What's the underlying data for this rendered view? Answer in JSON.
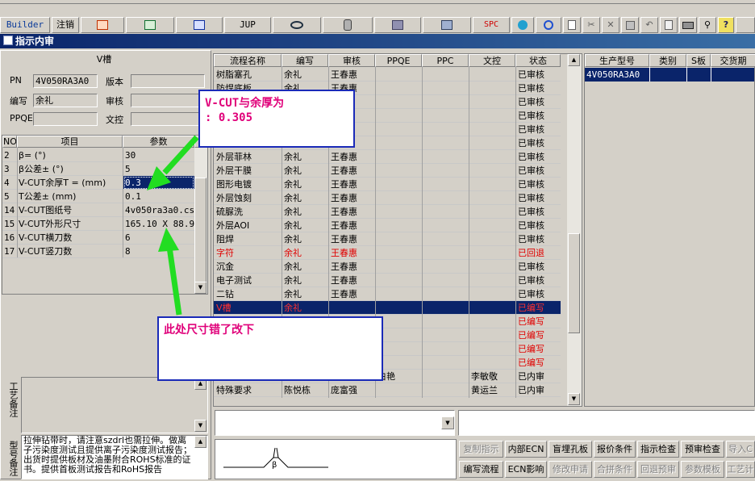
{
  "toolbar": {
    "builder_label": "Builder",
    "logout_label": "注销",
    "jup_label": "JUP",
    "spc_label": "SPC",
    "icons": [
      "ppt-icon",
      "excel-icon",
      "word-icon",
      "eye-icon",
      "database-icon",
      "server-icon",
      "printer-queue-icon",
      "spc",
      "globe-icon",
      "refresh-icon",
      "new-doc-icon",
      "cut-icon",
      "delete-icon",
      "save-icon",
      "undo-icon",
      "preview-icon",
      "print-icon",
      "find-icon",
      "help-icon"
    ]
  },
  "window": {
    "title": "指示内审"
  },
  "left": {
    "header": "V槽",
    "pn_label": "PN",
    "pn_value": "4V050RA3A0",
    "version_label": "版本",
    "author_label": "编写",
    "author_value": "余礼",
    "review_label": "审核",
    "ppqe_label": "PPQE",
    "control_label": "文控",
    "param_columns": [
      "NO",
      "项目",
      "参数"
    ],
    "params": [
      {
        "no": "2",
        "item": "β=  (°)",
        "value": "30"
      },
      {
        "no": "3",
        "item": "β公差±  (°)",
        "value": "5"
      },
      {
        "no": "4",
        "item": "V-CUT余厚T =  (mm)",
        "value": "0.3"
      },
      {
        "no": "5",
        "item": "T公差±  (mm)",
        "value": "0.1"
      },
      {
        "no": "14",
        "item": "V-CUT图纸号",
        "value": "4v050ra3a0.csv"
      },
      {
        "no": "15",
        "item": "V-CUT外形尺寸",
        "value": "165.10 X 88.90"
      },
      {
        "no": "16",
        "item": "V-CUT横刀数",
        "value": "6"
      },
      {
        "no": "17",
        "item": "V-CUT竖刀数",
        "value": "8"
      }
    ],
    "craft_note_label": "工艺备注",
    "model_note_label": "型号备注",
    "model_note_text": "拉伸钻带时，请注意szdrl也需拉伸。做离子污染度测试且提供离子污染度测试报告；出货时提供板材及油墨附合ROHS标准的证书。提供首板测试报告和RoHS报告"
  },
  "flow": {
    "columns": [
      "流程名称",
      "编写",
      "审核",
      "PPQE",
      "PPC",
      "文控",
      "状态"
    ],
    "rows": [
      {
        "name": "树脂塞孔",
        "author": "余礼",
        "reviewer": "王春惠",
        "ppqe": "",
        "ppc": "",
        "control": "",
        "status": "已审核",
        "style": "normal"
      },
      {
        "name": "防焊底板",
        "author": "余礼",
        "reviewer": "王春惠",
        "ppqe": "",
        "ppc": "",
        "control": "",
        "status": "已审核",
        "style": "normal"
      },
      {
        "name": "",
        "author": "",
        "reviewer": "",
        "ppqe": "",
        "ppc": "",
        "control": "",
        "status": "已审核",
        "style": "normal"
      },
      {
        "name": "",
        "author": "",
        "reviewer": "",
        "ppqe": "",
        "ppc": "",
        "control": "",
        "status": "已审核",
        "style": "normal"
      },
      {
        "name": "",
        "author": "",
        "reviewer": "",
        "ppqe": "",
        "ppc": "",
        "control": "",
        "status": "已审核",
        "style": "normal"
      },
      {
        "name": "",
        "author": "",
        "reviewer": "",
        "ppqe": "",
        "ppc": "",
        "control": "",
        "status": "已审核",
        "style": "normal"
      },
      {
        "name": "外层菲林",
        "author": "余礼",
        "reviewer": "王春惠",
        "ppqe": "",
        "ppc": "",
        "control": "",
        "status": "已审核",
        "style": "normal"
      },
      {
        "name": "外层干膜",
        "author": "余礼",
        "reviewer": "王春惠",
        "ppqe": "",
        "ppc": "",
        "control": "",
        "status": "已审核",
        "style": "normal"
      },
      {
        "name": "图形电镀",
        "author": "余礼",
        "reviewer": "王春惠",
        "ppqe": "",
        "ppc": "",
        "control": "",
        "status": "已审核",
        "style": "normal"
      },
      {
        "name": "外层蚀刻",
        "author": "余礼",
        "reviewer": "王春惠",
        "ppqe": "",
        "ppc": "",
        "control": "",
        "status": "已审核",
        "style": "normal"
      },
      {
        "name": "硫脲洗",
        "author": "余礼",
        "reviewer": "王春惠",
        "ppqe": "",
        "ppc": "",
        "control": "",
        "status": "已审核",
        "style": "normal"
      },
      {
        "name": "外层AOI",
        "author": "余礼",
        "reviewer": "王春惠",
        "ppqe": "",
        "ppc": "",
        "control": "",
        "status": "已审核",
        "style": "normal"
      },
      {
        "name": "阻焊",
        "author": "余礼",
        "reviewer": "王春惠",
        "ppqe": "",
        "ppc": "",
        "control": "",
        "status": "已审核",
        "style": "normal"
      },
      {
        "name": "字符",
        "author": "余礼",
        "reviewer": "王春惠",
        "ppqe": "",
        "ppc": "",
        "control": "",
        "status": "已回退",
        "style": "red"
      },
      {
        "name": "沉金",
        "author": "余礼",
        "reviewer": "王春惠",
        "ppqe": "",
        "ppc": "",
        "control": "",
        "status": "已审核",
        "style": "normal"
      },
      {
        "name": "电子测试",
        "author": "余礼",
        "reviewer": "王春惠",
        "ppqe": "",
        "ppc": "",
        "control": "",
        "status": "已审核",
        "style": "normal"
      },
      {
        "name": "二钻",
        "author": "余礼",
        "reviewer": "王春惠",
        "ppqe": "",
        "ppc": "",
        "control": "",
        "status": "已审核",
        "style": "normal"
      },
      {
        "name": "V槽",
        "author": "余礼",
        "reviewer": "",
        "ppqe": "",
        "ppc": "",
        "control": "",
        "status": "已编写",
        "style": "selected"
      },
      {
        "name": "",
        "author": "",
        "reviewer": "",
        "ppqe": "",
        "ppc": "",
        "control": "",
        "status": "已编写",
        "style": "red"
      },
      {
        "name": "",
        "author": "",
        "reviewer": "",
        "ppqe": "",
        "ppc": "",
        "control": "",
        "status": "已编写",
        "style": "red"
      },
      {
        "name": "",
        "author": "",
        "reviewer": "",
        "ppqe": "",
        "ppc": "",
        "control": "",
        "status": "已编写",
        "style": "red"
      },
      {
        "name": "",
        "author": "",
        "reviewer": "",
        "ppqe": "",
        "ppc": "",
        "control": "",
        "status": "已编写",
        "style": "red"
      },
      {
        "name": "",
        "author": "",
        "reviewer": "",
        "ppqe": "白艳",
        "ppc": "",
        "control": "李敏敬",
        "status": "已内审",
        "style": "normal"
      },
      {
        "name": "特殊要求",
        "author": "陈悦栋",
        "reviewer": "庞富强",
        "ppqe": "",
        "ppc": "",
        "control": "黄运兰",
        "status": "已内审",
        "style": "normal"
      }
    ]
  },
  "models": {
    "columns": [
      "生产型号",
      "类别",
      "S板",
      "交货期"
    ],
    "rows": [
      {
        "model": "4V050RA3A0",
        "category": "",
        "s": "",
        "delivery": ""
      }
    ]
  },
  "buttons": {
    "row1": [
      {
        "label": "复制指示",
        "enabled": false
      },
      {
        "label": "内部ECN",
        "enabled": true
      },
      {
        "label": "盲埋孔板",
        "enabled": true
      },
      {
        "label": "报价条件",
        "enabled": true
      },
      {
        "label": "指示检查",
        "enabled": true
      },
      {
        "label": "预审检查",
        "enabled": true
      },
      {
        "label": "导入C",
        "enabled": false
      }
    ],
    "row2": [
      {
        "label": "编写流程",
        "enabled": true
      },
      {
        "label": "ECN影响",
        "enabled": true
      },
      {
        "label": "修改申请",
        "enabled": false
      },
      {
        "label": "合拼条件",
        "enabled": false
      },
      {
        "label": "回退预审",
        "enabled": false
      },
      {
        "label": "参数模板",
        "enabled": false
      },
      {
        "label": "工艺计",
        "enabled": false
      }
    ]
  },
  "diagram": {
    "beta_label": "β"
  },
  "callouts": {
    "top_line1": "V-CUT与余厚为",
    "top_line2": ": 0.305",
    "bottom": "此处尺寸错了改下",
    "arrow_color": "#22dd22"
  }
}
